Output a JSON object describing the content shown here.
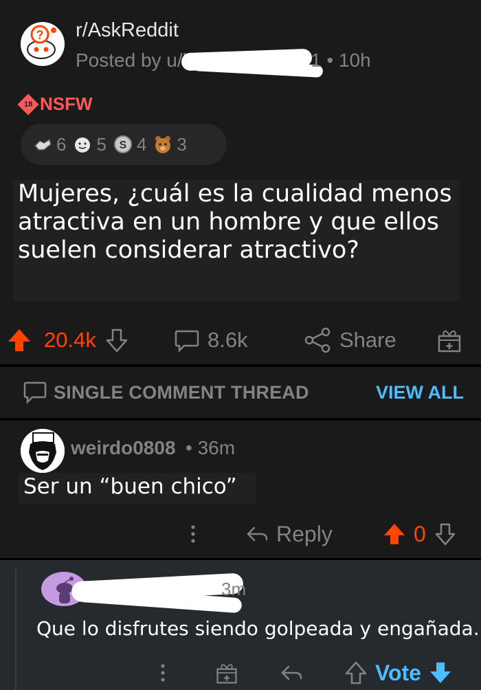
{
  "post": {
    "subreddit": "r/AskReddit",
    "posted_by_prefix": "Posted by u/l",
    "posted_suffix": "1 • 10h",
    "nsfw_badge": "18",
    "nsfw_label": "NSFW",
    "awards": [
      {
        "icon": "handshake-award-icon",
        "count": "6"
      },
      {
        "icon": "wholesome-award-icon",
        "count": "5"
      },
      {
        "icon": "silver-award-icon",
        "count": "4"
      },
      {
        "icon": "bear-award-icon",
        "count": "3"
      }
    ],
    "title": "Mujeres, ¿cuál es la cualidad menos atractiva en un hombre y que ellos suelen considerar atractivo?",
    "score": "20.4k",
    "comments": "8.6k",
    "share_label": "Share"
  },
  "thread": {
    "label": "SINGLE COMMENT THREAD",
    "view_all": "VIEW ALL"
  },
  "comment": {
    "username": "weirdo0808",
    "time": "• 36m",
    "text": "Ser un “buen chico”",
    "reply_label": "Reply",
    "score": "0"
  },
  "reply": {
    "time_fragment": "3m",
    "text": "Que lo disfrutes siendo golpeada y engañada.",
    "vote_label": "Vote"
  },
  "colors": {
    "upvote": "#ff4500",
    "link": "#4fbcff",
    "nsfw": "#ff585b"
  }
}
